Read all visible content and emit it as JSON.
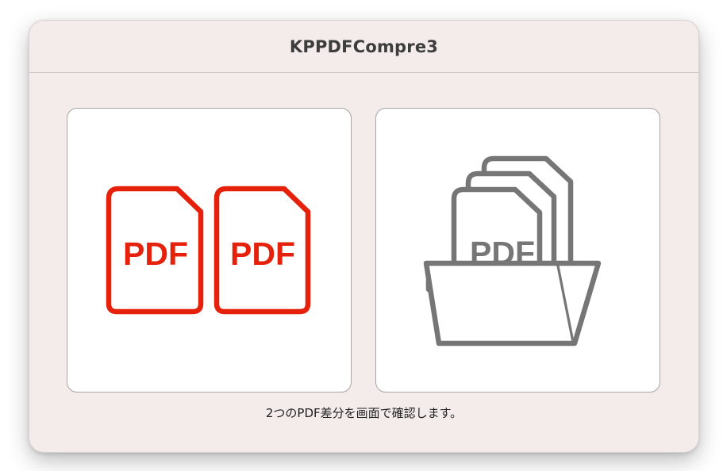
{
  "window": {
    "title": "KPPDFCompre3"
  },
  "buttons": [
    {
      "id": "compare-two-pdfs",
      "icon": "two-pdf-documents-icon",
      "label": "PDF",
      "color": "#e5200b"
    },
    {
      "id": "compare-pdf-folder",
      "icon": "pdf-folder-icon",
      "label": "PDF",
      "color": "#767676"
    }
  ],
  "caption": "2つのPDF差分を画面で確認します。"
}
